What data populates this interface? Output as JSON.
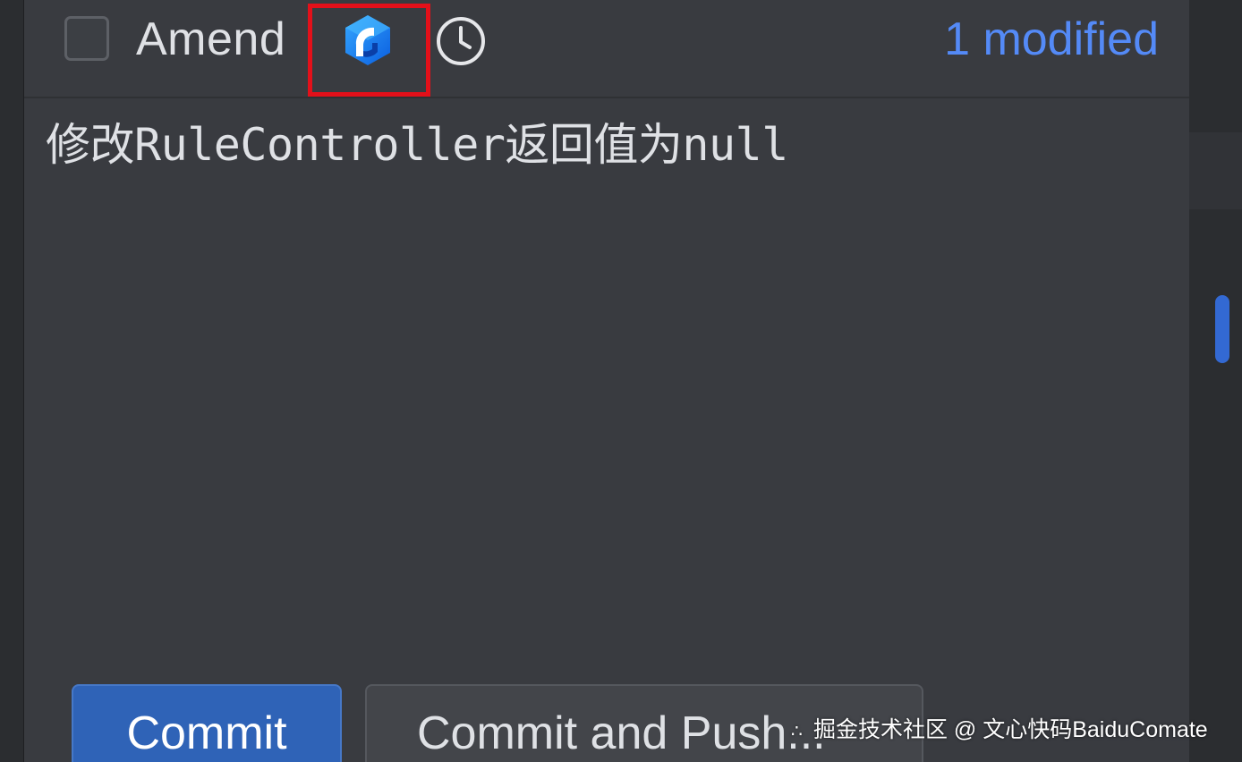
{
  "toolbar": {
    "amend_label": "Amend",
    "amend_checked": false,
    "comate_icon": "baidu-comate-icon",
    "history_icon": "clock-icon",
    "modified_text": "1 modified"
  },
  "message": {
    "text": "修改RuleController返回值为null"
  },
  "buttons": {
    "commit_label": "Commit",
    "commit_push_label": "Commit and Push..."
  },
  "watermark": {
    "text": "掘金技术社区 @ 文心快码BaiduComate"
  },
  "colors": {
    "panel_bg": "#393b40",
    "accent_link": "#548af7",
    "primary_button": "#2f63b7",
    "highlight_box": "#e3101a",
    "comate_blue": "#1a7cf0"
  }
}
